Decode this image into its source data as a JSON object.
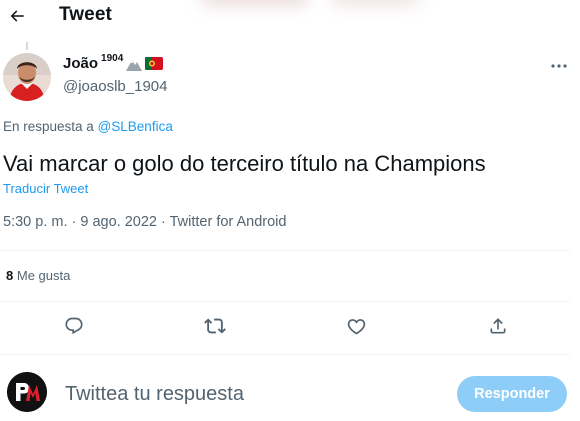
{
  "header": {
    "title": "Tweet",
    "back_icon": "arrow-left-icon"
  },
  "tweet": {
    "author": {
      "display_name": "João",
      "name_superscript": "1904",
      "handle": "@joaoslb_1904",
      "badges": [
        "mountain-emoji-icon",
        "portugal-flag-icon"
      ]
    },
    "reply_prefix": "En respuesta a",
    "reply_to": "@SLBenfica",
    "text": "Vai marcar o golo do terceiro título na Champions",
    "translate_label": "Traducir Tweet",
    "meta": "5:30 p. m. · 9 ago. 2022 · Twitter for Android",
    "likes_count": "8",
    "likes_label": "Me gusta"
  },
  "actions": [
    "reply-icon",
    "retweet-icon",
    "like-icon",
    "share-icon"
  ],
  "composer": {
    "placeholder": "Twittea tu respuesta",
    "submit_label": "Responder"
  },
  "colors": {
    "accent": "#1d9bf0",
    "secondary_text": "#536471",
    "disabled_button": "#8ecdf7"
  }
}
